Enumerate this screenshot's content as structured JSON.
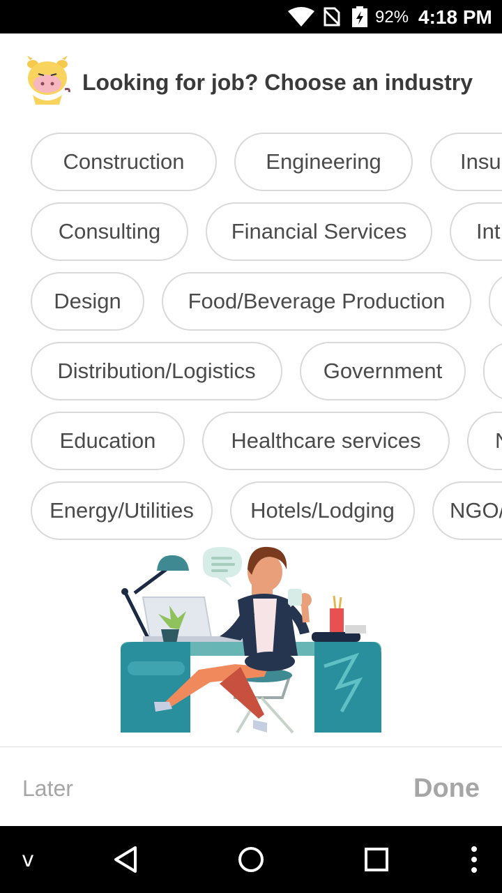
{
  "status_bar": {
    "battery_percent": "92%",
    "time": "4:18 PM",
    "icons": [
      "wifi-icon",
      "no-sim-icon",
      "battery-charging-icon"
    ]
  },
  "header": {
    "mascot_icon": "cow-mascot-icon",
    "title": "Looking for job? Choose an industry"
  },
  "industries": {
    "construction": "Construction",
    "engineering": "Engineering",
    "insurance_partial": "Insu",
    "consulting": "Consulting",
    "financial_services": "Financial Services",
    "int_partial": "Int",
    "design": "Design",
    "food_beverage": "Food/Beverage Production",
    "distribution_logistics": "Distribution/Logistics",
    "government": "Government",
    "education": "Education",
    "healthcare": "Healthcare services",
    "n_partial": "N",
    "energy_utilities": "Energy/Utilities",
    "hotels_lodging": "Hotels/Lodging",
    "ngo_partial": "NGO/"
  },
  "illustration": {
    "icon": "woman-at-desk-illustration"
  },
  "footer": {
    "later_label": "Later",
    "done_label": "Done"
  },
  "nav_bar": {
    "items": [
      "keyboard-hide-icon",
      "back-icon",
      "home-icon",
      "recents-icon",
      "more-options-icon"
    ],
    "keyboard_glyph": "v"
  },
  "colors": {
    "chip_border": "#d9d9d9",
    "chip_text": "#4a4a4a",
    "title_text": "#3a3a3a",
    "footer_button_text": "#a6a6a6",
    "illustration_teal": "#2a8f9c"
  }
}
